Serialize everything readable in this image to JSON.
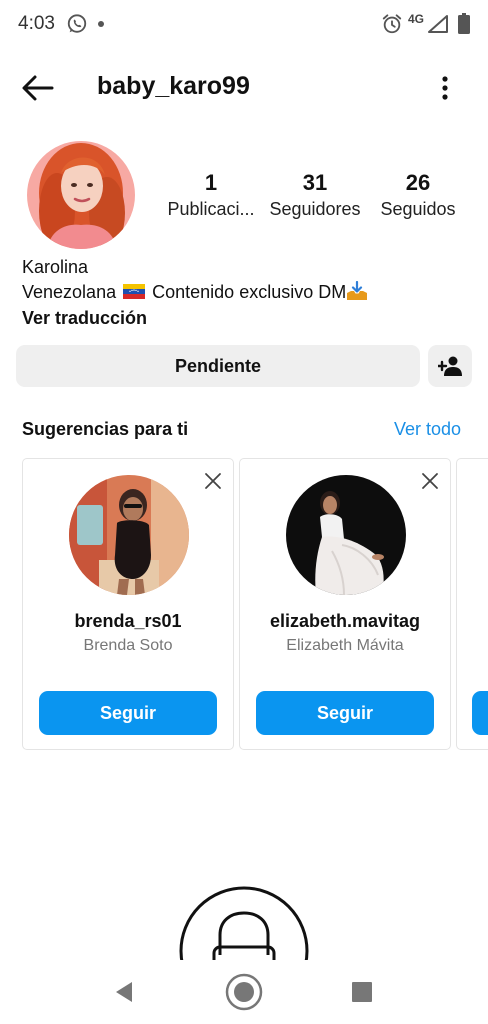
{
  "status_bar": {
    "time": "4:03",
    "network": "4G",
    "icons": [
      "whatsapp-icon",
      "notification-dot",
      "alarm-icon",
      "signal-icon",
      "battery-icon"
    ]
  },
  "header": {
    "username": "baby_karo99",
    "back_icon": "arrow-left-icon",
    "more_icon": "more-vertical-icon"
  },
  "profile": {
    "stats": [
      {
        "value": "1",
        "label": "Publicaci..."
      },
      {
        "value": "31",
        "label": "Seguidores"
      },
      {
        "value": "26",
        "label": "Seguidos"
      }
    ],
    "display_name": "Karolina",
    "bio_before_flag": "Venezolana",
    "bio_after_flag": "Contenido exclusivo DM",
    "translate_label": "Ver traducción",
    "pending_label": "Pendiente"
  },
  "suggestions": {
    "title": "Sugerencias para ti",
    "see_all": "Ver todo",
    "cards": [
      {
        "username": "brenda_rs01",
        "name": "Brenda Soto",
        "follow_label": "Seguir"
      },
      {
        "username": "elizabeth.mavitag",
        "name": "Elizabeth Mávita",
        "follow_label": "Seguir"
      }
    ]
  },
  "colors": {
    "accent": "#0a95f0",
    "link": "#1a8fe6",
    "button_gray": "#efefef",
    "text": "#111111",
    "secondary_text": "#777777"
  }
}
